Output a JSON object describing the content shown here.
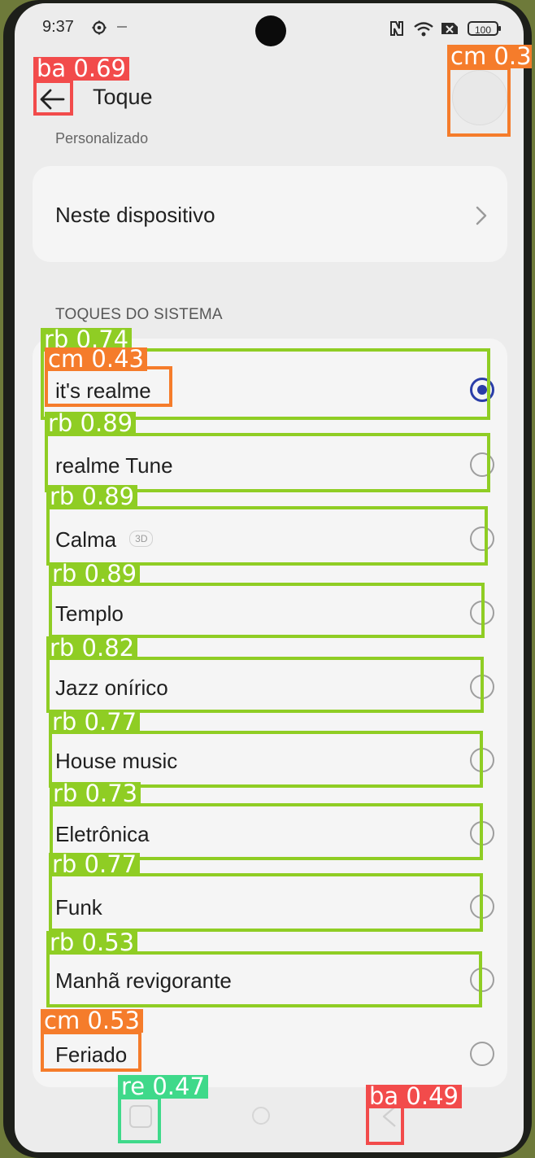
{
  "status_bar": {
    "time": "9:37",
    "battery": "100"
  },
  "header": {
    "title": "Toque"
  },
  "section_cut": "Personalizado",
  "device_item": {
    "label": "Neste dispositivo"
  },
  "section_title": "TOQUES DO SISTEMA",
  "ringtones": [
    {
      "label": "it's realme",
      "selected": true
    },
    {
      "label": "realme Tune",
      "selected": false
    },
    {
      "label": "Calma",
      "badge": "3D",
      "selected": false
    },
    {
      "label": "Templo",
      "selected": false
    },
    {
      "label": "Jazz onírico",
      "selected": false
    },
    {
      "label": "House music",
      "selected": false
    },
    {
      "label": "Eletrônica",
      "selected": false
    },
    {
      "label": "Funk",
      "selected": false
    },
    {
      "label": "Manhã revigorante",
      "selected": false
    },
    {
      "label": "Feriado",
      "selected": false
    }
  ],
  "detections": [
    {
      "label": "ba 0.69",
      "color": "#f24b4b"
    },
    {
      "label": "cm 0.3",
      "color": "#f57c2b"
    },
    {
      "label": "rb 0.74",
      "color": "#8fcd24"
    },
    {
      "label": "cm 0.43",
      "color": "#f57c2b"
    },
    {
      "label": "rb 0.89",
      "color": "#8fcd24"
    },
    {
      "label": "rb 0.89",
      "color": "#8fcd24"
    },
    {
      "label": "rb 0.89",
      "color": "#8fcd24"
    },
    {
      "label": "rb 0.82",
      "color": "#8fcd24"
    },
    {
      "label": "rb 0.77",
      "color": "#8fcd24"
    },
    {
      "label": "rb 0.73",
      "color": "#8fcd24"
    },
    {
      "label": "rb 0.77",
      "color": "#8fcd24"
    },
    {
      "label": "rb 0.53",
      "color": "#8fcd24"
    },
    {
      "label": "cm 0.53",
      "color": "#f57c2b"
    },
    {
      "label": "re 0.47",
      "color": "#3fd98a"
    },
    {
      "label": "ba 0.49",
      "color": "#f24b4b"
    }
  ]
}
